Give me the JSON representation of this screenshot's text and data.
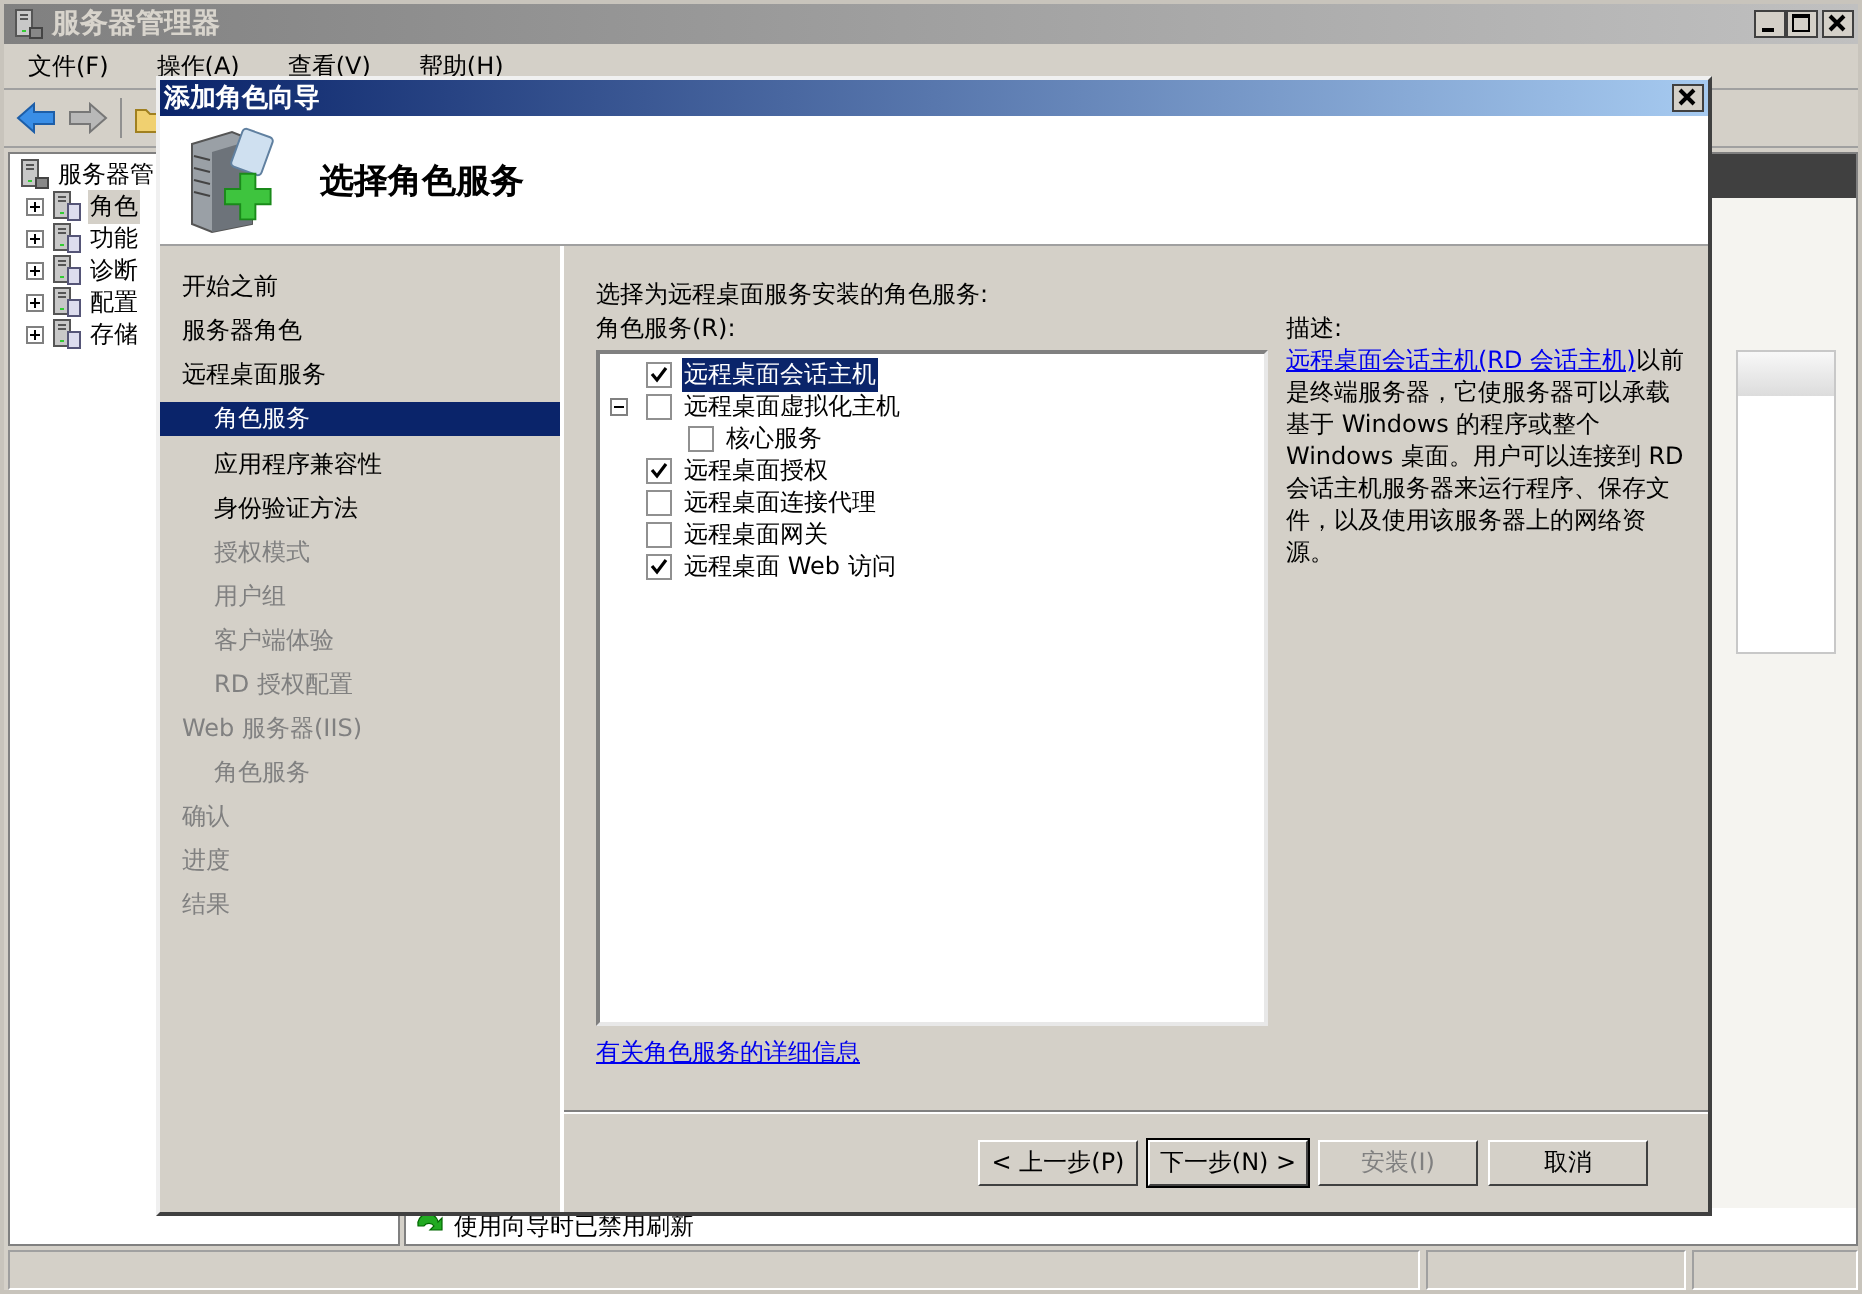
{
  "main_window": {
    "title": "服务器管理器",
    "menu": [
      "文件(F)",
      "操作(A)",
      "查看(V)",
      "帮助(H)"
    ],
    "tree": {
      "label": "服务器管",
      "children": [
        {
          "label": "角色",
          "expanded": false,
          "selected": true
        },
        {
          "label": "功能",
          "expanded": false,
          "selected": false
        },
        {
          "label": "诊断",
          "expanded": false,
          "selected": false
        },
        {
          "label": "配置",
          "expanded": false,
          "selected": false
        },
        {
          "label": "存储",
          "expanded": false,
          "selected": false
        }
      ]
    },
    "status_message": "使用向导时已禁用刷新"
  },
  "dialog": {
    "title": "添加角色向导",
    "heading": "选择角色服务",
    "steps": [
      {
        "label": "开始之前",
        "selected": false,
        "disabled": false
      },
      {
        "label": "服务器角色",
        "selected": false,
        "disabled": false
      },
      {
        "label": "远程桌面服务",
        "selected": false,
        "disabled": false,
        "children": [
          {
            "label": "角色服务",
            "selected": true,
            "disabled": false
          },
          {
            "label": "应用程序兼容性",
            "selected": false,
            "disabled": false
          },
          {
            "label": "身份验证方法",
            "selected": false,
            "disabled": false
          },
          {
            "label": "授权模式",
            "selected": false,
            "disabled": true
          },
          {
            "label": "用户组",
            "selected": false,
            "disabled": true
          },
          {
            "label": "客户端体验",
            "selected": false,
            "disabled": true
          },
          {
            "label": "RD 授权配置",
            "selected": false,
            "disabled": true
          }
        ]
      },
      {
        "label": "Web 服务器(IIS)",
        "selected": false,
        "disabled": true,
        "children": [
          {
            "label": "角色服务",
            "selected": false,
            "disabled": true
          }
        ]
      },
      {
        "label": "确认",
        "selected": false,
        "disabled": true
      },
      {
        "label": "进度",
        "selected": false,
        "disabled": true
      },
      {
        "label": "结果",
        "selected": false,
        "disabled": true
      }
    ],
    "instruction": "选择为远程桌面服务安装的角色服务:",
    "list_label": "角色服务(R):",
    "role_services": [
      {
        "label": "远程桌面会话主机",
        "checked": true,
        "selected": true
      },
      {
        "label": "远程桌面虚拟化主机",
        "checked": false,
        "selected": false,
        "expanded": true,
        "children": [
          {
            "label": "核心服务",
            "checked": false,
            "selected": false
          }
        ]
      },
      {
        "label": "远程桌面授权",
        "checked": true,
        "selected": false
      },
      {
        "label": "远程桌面连接代理",
        "checked": false,
        "selected": false
      },
      {
        "label": "远程桌面网关",
        "checked": false,
        "selected": false
      },
      {
        "label": "远程桌面 Web 访问",
        "checked": true,
        "selected": false
      }
    ],
    "description": {
      "label": "描述:",
      "link": "远程桌面会话主机(RD 会话主机)",
      "text": "以前是终端服务器，它使服务器可以承载基于 Windows 的程序或整个 Windows 桌面。用户可以连接到 RD 会话主机服务器来运行程序、保存文件，以及使用该服务器上的网络资源。"
    },
    "more_info_link": "有关角色服务的详细信息",
    "buttons": [
      {
        "label": "< 上一步(P)",
        "disabled": false,
        "default": false
      },
      {
        "label": "下一步(N) >",
        "disabled": false,
        "default": true
      },
      {
        "label": "安装(I)",
        "disabled": true,
        "default": false
      },
      {
        "label": "取消",
        "disabled": false,
        "default": false
      }
    ]
  }
}
